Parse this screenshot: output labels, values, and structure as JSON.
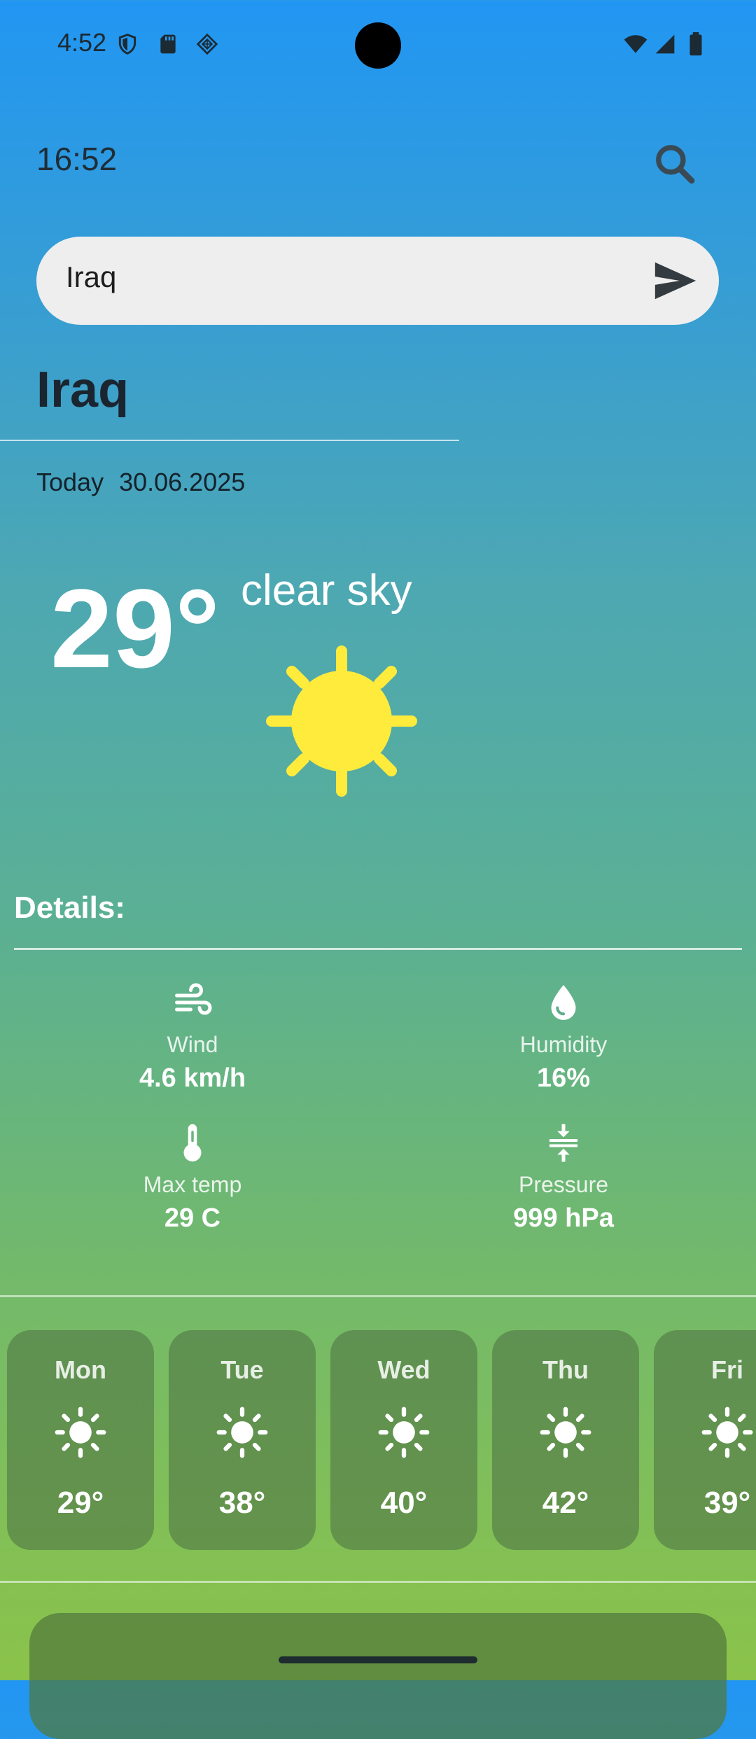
{
  "status_bar": {
    "time": "4:52",
    "icons": [
      "shield-icon",
      "sd-card-icon",
      "sim-card-icon",
      "wifi-icon",
      "signal-icon",
      "battery-icon"
    ]
  },
  "header": {
    "clock": "16:52",
    "search_icon": "search-icon"
  },
  "search": {
    "value": "Iraq",
    "send_icon": "send-icon"
  },
  "location": {
    "city": "Iraq",
    "date_prefix": "Today",
    "date": "30.06.2025"
  },
  "current": {
    "temperature": "29°",
    "condition": "clear sky",
    "icon": "sun-icon"
  },
  "details": {
    "title": "Details:",
    "wind": {
      "label": "Wind",
      "value": "4.6 km/h",
      "icon": "wind-icon"
    },
    "humidity": {
      "label": "Humidity",
      "value": "16%",
      "icon": "water-drop-icon"
    },
    "max_temp": {
      "label": "Max temp",
      "value": "29 C",
      "icon": "thermometer-icon"
    },
    "pressure": {
      "label": "Pressure",
      "value": "999 hPa",
      "icon": "pressure-icon"
    }
  },
  "forecast": [
    {
      "day": "Mon",
      "temp": "29°",
      "icon": "sun-icon"
    },
    {
      "day": "Tue",
      "temp": "38°",
      "icon": "sun-icon"
    },
    {
      "day": "Wed",
      "temp": "40°",
      "icon": "sun-icon"
    },
    {
      "day": "Thu",
      "temp": "42°",
      "icon": "sun-icon"
    },
    {
      "day": "Fri",
      "temp": "39°",
      "icon": "sun-icon"
    }
  ],
  "colors": {
    "gradient_top": "#2196F3",
    "gradient_bottom": "#8BC34A",
    "sun": "#FFEB3B",
    "search_bar": "#EEEEEE"
  }
}
